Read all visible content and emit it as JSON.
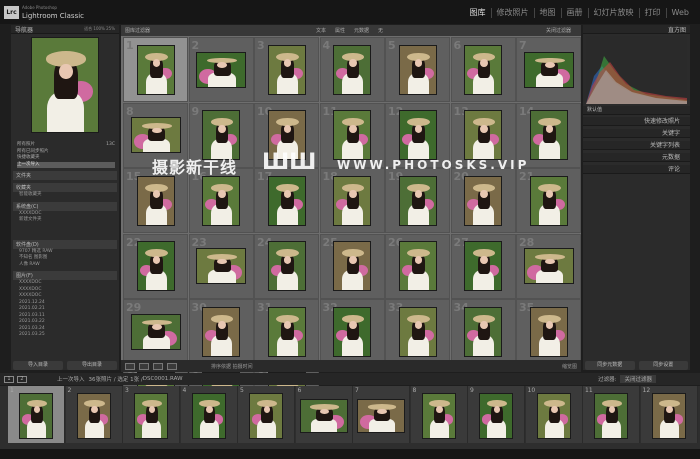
{
  "app": {
    "logo": "Lrc",
    "subtitle": "Adobe Photoshop",
    "name": "Lightroom Classic"
  },
  "modules": [
    {
      "label": "图库",
      "active": true
    },
    {
      "label": "修改照片"
    },
    {
      "label": "地图"
    },
    {
      "label": "画册"
    },
    {
      "label": "幻灯片放映"
    },
    {
      "label": "打印"
    },
    {
      "label": "Web"
    }
  ],
  "left": {
    "navigator": {
      "title": "导航器",
      "zoom": "适合  100%  25%"
    },
    "catalog": [
      {
        "label": "所有照片",
        "count": "13C"
      },
      {
        "label": "所有已同步照片",
        "count": ""
      },
      {
        "label": "快捷收藏夹",
        "count": ""
      },
      {
        "label": "上一次导入",
        "count": "",
        "selected": true
      }
    ],
    "sections": [
      {
        "title": "文件夹",
        "rows": []
      },
      {
        "title": "收藏夹",
        "rows": [
          {
            "label": "智能收藏夹",
            "count": ""
          }
        ]
      },
      {
        "title": "系统盘(C)",
        "rows": [
          {
            "label": "",
            "count": ""
          },
          {
            "label": "XXXXDOC",
            "count": ""
          },
          {
            "label": "",
            "count": ""
          },
          {
            "label": "新建文件夹",
            "count": ""
          }
        ]
      },
      {
        "title": "软件盘(D)",
        "rows": [
          {
            "label": "9707 精选 RAW",
            "count": ""
          },
          {
            "label": "不知名 图影图",
            "count": ""
          },
          {
            "label": "人像 RAW",
            "count": ""
          }
        ]
      },
      {
        "title": "图片(F)",
        "rows": [
          {
            "label": "XXXXDOC",
            "count": ""
          },
          {
            "label": "XXXXDOC",
            "count": ""
          },
          {
            "label": "XXXXDOC",
            "count": ""
          },
          {
            "label": "",
            "count": ""
          },
          {
            "label": "2021.12.24",
            "count": ""
          },
          {
            "label": "2021.02.21",
            "count": ""
          },
          {
            "label": "2021.03.11",
            "count": ""
          },
          {
            "label": "2021.03.22",
            "count": ""
          },
          {
            "label": "2021.03.24",
            "count": ""
          },
          {
            "label": "2021.03.25",
            "count": ""
          }
        ]
      }
    ],
    "import_label": "导入目录",
    "export_label": "导出目录"
  },
  "center": {
    "filter_label": "图库过滤器",
    "filters": [
      "文本",
      "属性",
      "元数据",
      "无"
    ],
    "filter_right": "关闭过滤器",
    "grid_numbers": [
      "1",
      "2",
      "3",
      "4",
      "5",
      "6",
      "7",
      "8",
      "9",
      "10",
      "11",
      "12",
      "13",
      "14",
      "15",
      "16",
      "17",
      "18",
      "19",
      "20",
      "21",
      "22",
      "23",
      "24",
      "25",
      "26",
      "27",
      "28",
      "29",
      "30",
      "31",
      "32",
      "33",
      "34",
      "35",
      "36",
      "37",
      "38"
    ],
    "sort_label": "排序依据",
    "sort_value": "拍摄时间",
    "thumb_label": "缩览图"
  },
  "watermark": {
    "a": "摄影新干线",
    "b": "ШШ",
    "c": "WWW.PHOTOSKS.VIP"
  },
  "right": {
    "histogram": "直方图",
    "rows": [
      "快速修改照片",
      "关键字",
      "关键字列表",
      "元数据",
      "评论"
    ],
    "meta_preset": "默认值",
    "sync_meta": "同步元数据",
    "sync_settings": "同步设置"
  },
  "filmbar": {
    "pages": [
      "1",
      "2"
    ],
    "source": "上一次导入",
    "info": "36张照片 / 选定 1张 / ",
    "file": "DSC0001.RAW",
    "filter": "过滤器:",
    "filter_value": "关闭过滤器"
  },
  "film_numbers": [
    "1",
    "2",
    "3",
    "4",
    "5",
    "6",
    "7",
    "8",
    "9",
    "10",
    "11",
    "12"
  ],
  "colors": {
    "accent": "#5c5c5c",
    "bg": "#1e1e1e"
  }
}
